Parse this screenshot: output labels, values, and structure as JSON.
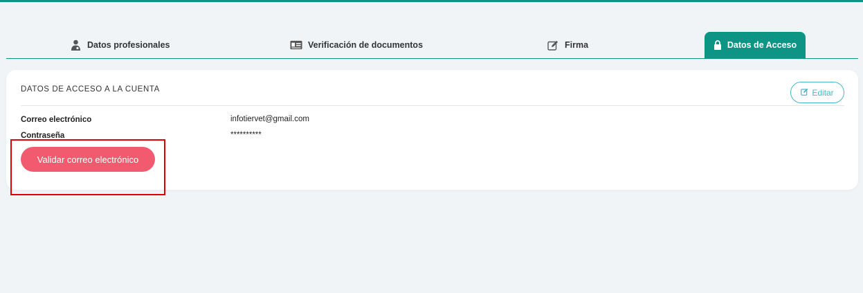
{
  "colors": {
    "accent": "#0e9484",
    "danger_button": "#f25a6f",
    "edit_outline": "#49b6c4",
    "highlight": "#e00000"
  },
  "tabs": [
    {
      "label": "Datos profesionales",
      "icon": "doctor-icon",
      "active": false
    },
    {
      "label": "Verificación de documentos",
      "icon": "id-card-icon",
      "active": false
    },
    {
      "label": "Firma",
      "icon": "pen-square-icon",
      "active": false
    },
    {
      "label": "Datos de Acceso",
      "icon": "lock-icon",
      "active": true
    }
  ],
  "card": {
    "title": "DATOS DE ACCESO A LA CUENTA",
    "edit_label": "Editar",
    "fields": [
      {
        "label": "Correo electrónico",
        "value": "infotiervet@gmail.com"
      },
      {
        "label": "Contraseña",
        "value": "**********"
      }
    ],
    "validate_label": "Validar correo electrónico"
  }
}
